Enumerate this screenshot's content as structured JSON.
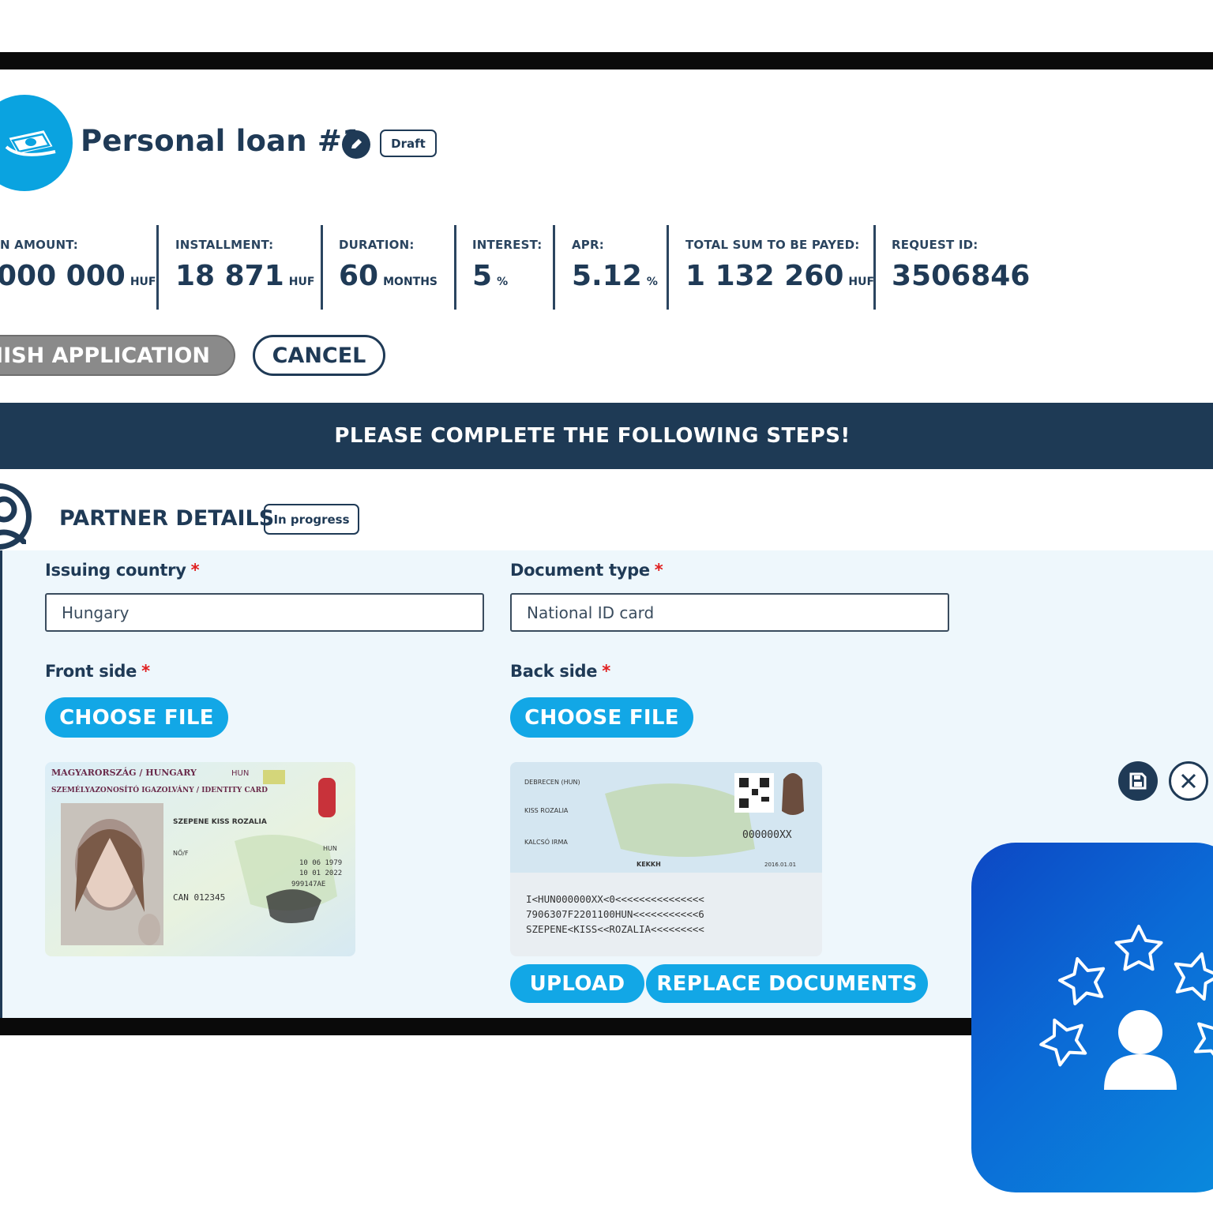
{
  "loan": {
    "title": "Personal loan #1",
    "status": "Draft"
  },
  "metrics": [
    {
      "label": "N AMOUNT:",
      "value": "000 000",
      "unit": "HUF"
    },
    {
      "label": "INSTALLMENT:",
      "value": "18 871",
      "unit": "HUF"
    },
    {
      "label": "DURATION:",
      "value": "60",
      "unit": "MONTHS"
    },
    {
      "label": "INTEREST:",
      "value": "5",
      "unit": "%"
    },
    {
      "label": "APR:",
      "value": "5.12",
      "unit": "%"
    },
    {
      "label": "TOTAL SUM TO BE PAYED:",
      "value": "1 132 260",
      "unit": "HUF"
    },
    {
      "label": "REQUEST ID:",
      "value": "3506846",
      "unit": ""
    }
  ],
  "actions": {
    "finish": "INISH APPLICATION",
    "cancel": "CANCEL"
  },
  "banner": "PLEASE COMPLETE THE FOLLOWING STEPS!",
  "partner": {
    "title": "PARTNER DETAILS",
    "status": "In progress",
    "issuing_country_label": "Issuing country",
    "issuing_country_value": "Hungary",
    "document_type_label": "Document type",
    "document_type_value": "National ID card",
    "front_label": "Front side",
    "back_label": "Back side",
    "required_mark": "*",
    "choose_file": "CHOOSE FILE",
    "upload": "UPLOAD",
    "replace": "REPLACE DOCUMENTS"
  },
  "id_front": {
    "header1": "MAGYARORSZÁG / HUNGARY",
    "header2": "SZEMÉLYAZONOSÍTÓ IGAZOLVÁNY / IDENTITY CARD",
    "country_code": "HUN",
    "name": "SZEPENE KISS ROZALIA",
    "sex": "NŐ/F",
    "nationality": "HUN",
    "birth": "10 06 1979",
    "expiry": "10 01 2022",
    "doc_no": "999147AE",
    "can": "CAN 012345"
  },
  "id_back": {
    "place_of_birth": "DEBRECEN (HUN)",
    "mother_line": "KISS ROZALIA",
    "mother_maiden": "KALCSÓ IRMA",
    "authority": "KEKKH",
    "number": "000000XX",
    "date": "2016.01.01",
    "mrz1": "I<HUN000000XX<0<<<<<<<<<<<<<<<",
    "mrz2": "7906307F2201100HUN<<<<<<<<<<<6",
    "mrz3": "SZEPENE<KISS<<ROZALIA<<<<<<<<<"
  },
  "colors": {
    "navy": "#1f3a56",
    "accent": "#12a7e6",
    "banner": "#1e3a55",
    "panel": "#eef7fc",
    "tile": "#0b6ad6"
  },
  "icons": {
    "loan": "money-bill-icon",
    "edit": "pencil-icon",
    "partner": "person-icon",
    "save": "floppy-disk-icon",
    "close": "close-icon",
    "tile": "person-with-stars-icon"
  }
}
